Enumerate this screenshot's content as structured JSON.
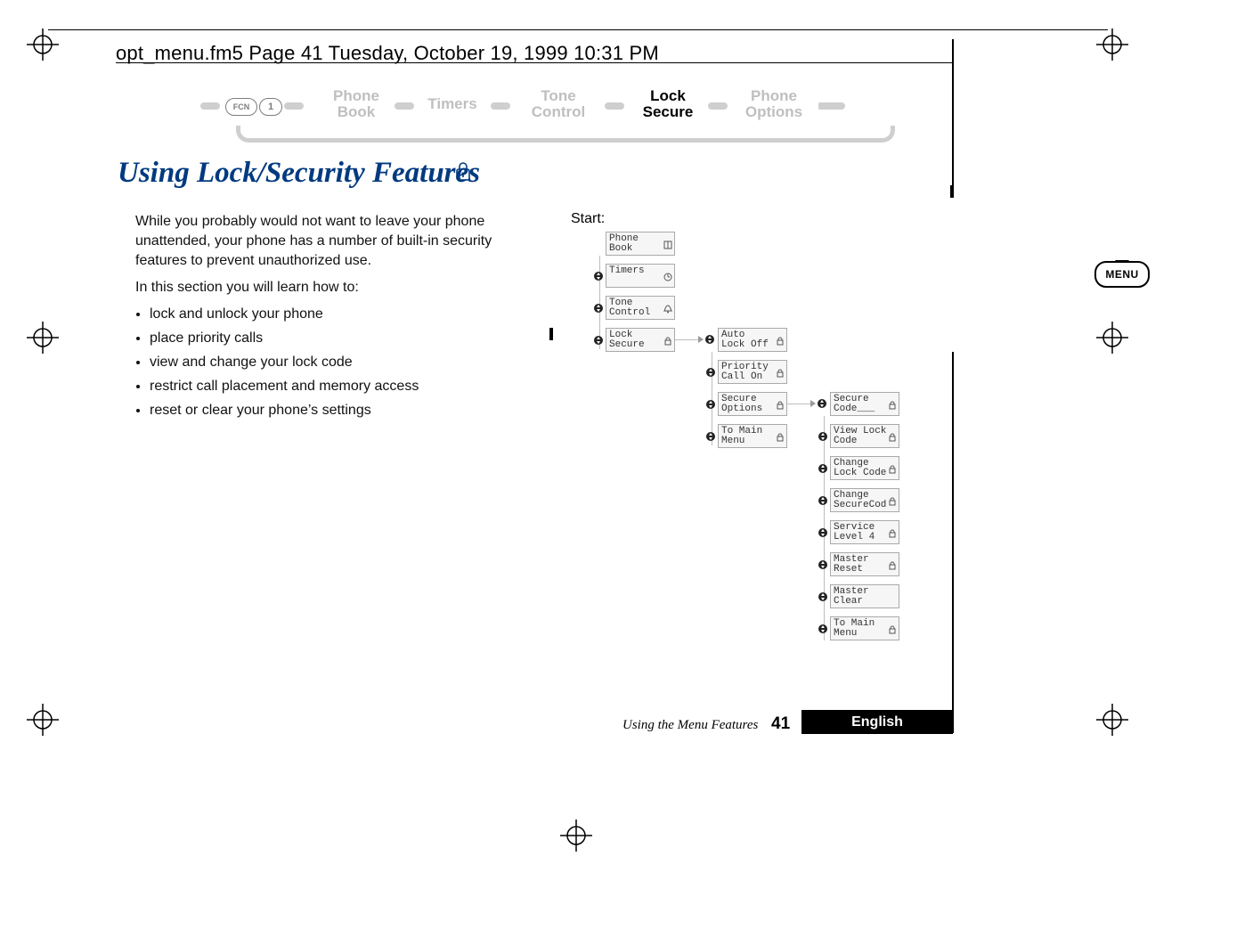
{
  "header_text": "opt_menu.fm5  Page 41  Tuesday, October 19, 1999  10:31 PM",
  "nav": {
    "key_fcn": "FCN",
    "key_1": "1",
    "items": [
      {
        "line1": "Phone",
        "line2": "Book",
        "active": false
      },
      {
        "line1": "Timers",
        "line2": "",
        "active": false
      },
      {
        "line1": "Tone",
        "line2": "Control",
        "active": false
      },
      {
        "line1": "Lock",
        "line2": "Secure",
        "active": true
      },
      {
        "line1": "Phone",
        "line2": "Options",
        "active": false
      }
    ]
  },
  "title": "Using Lock/Security Features",
  "intro_para": "While you probably would not want to leave your phone unattended, your phone has a number of built-in security features to prevent unauthorized use.",
  "intro_lead": "In this section you will learn how to:",
  "bullets": [
    "lock and unlock your phone",
    "place priority calls",
    "view and change your lock code",
    "restrict call placement and memory access",
    "reset or clear your phone’s settings"
  ],
  "start_label": "Start:",
  "tree_col1": [
    {
      "l1": "Phone",
      "l2": "Book",
      "icon": "book"
    },
    {
      "l1": "Timers",
      "l2": "",
      "icon": "clock"
    },
    {
      "l1": "Tone",
      "l2": "Control",
      "icon": "bell"
    },
    {
      "l1": "Lock",
      "l2": "Secure",
      "icon": "lock"
    }
  ],
  "tree_col2": [
    {
      "l1": "Auto",
      "l2": "Lock Off",
      "icon": "lock"
    },
    {
      "l1": "Priority",
      "l2": "Call On",
      "icon": "lock"
    },
    {
      "l1": "Secure",
      "l2": "Options",
      "icon": "lock"
    },
    {
      "l1": "To Main",
      "l2": "Menu",
      "icon": "lock"
    }
  ],
  "tree_col3": [
    {
      "l1": "Secure",
      "l2": "Code___",
      "icon": "lock"
    },
    {
      "l1": "View Lock",
      "l2": "Code",
      "icon": "lock"
    },
    {
      "l1": "Change",
      "l2": "Lock Code",
      "icon": "lock"
    },
    {
      "l1": "Change",
      "l2": "SecureCod",
      "icon": "lock"
    },
    {
      "l1": "Service",
      "l2": "Level 4",
      "icon": "lock"
    },
    {
      "l1": "Master",
      "l2": "Reset",
      "icon": "lock"
    },
    {
      "l1": "Master",
      "l2": "Clear",
      "icon": ""
    },
    {
      "l1": "To Main",
      "l2": "Menu",
      "icon": "lock"
    }
  ],
  "footer_text": "Using the Menu Features",
  "page_number": "41",
  "language": "English",
  "menu_tab": "MENU"
}
